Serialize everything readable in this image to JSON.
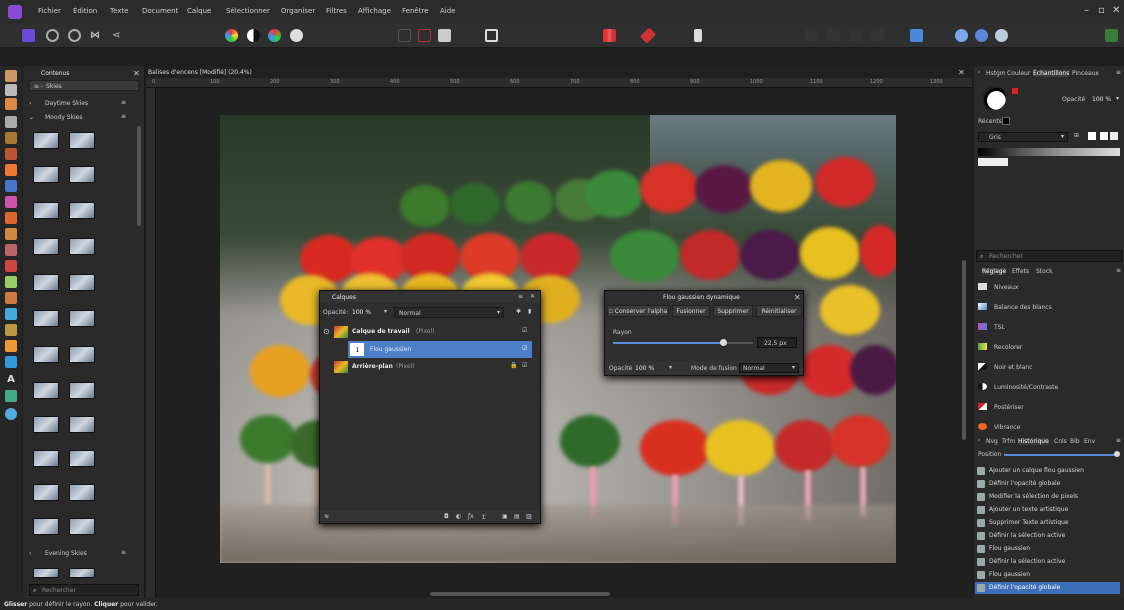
{
  "menu": [
    "Fichier",
    "Édition",
    "Texte",
    "Document",
    "Calque",
    "Sélectionner",
    "Organiser",
    "Filtres",
    "Affichage",
    "Fenêtre",
    "Aide"
  ],
  "window_controls": [
    "–",
    "▫",
    "✕"
  ],
  "left_panel": {
    "tab": "Contenus",
    "category": "Skies",
    "sections": [
      "Daytime Skies",
      "Moody Skies",
      "Evening Skies"
    ],
    "search_placeholder": "Rechercher"
  },
  "document_title": "Balises d'encens [Modifié] (20.4%)",
  "ruler_ticks": [
    "0",
    "100",
    "200",
    "300",
    "400",
    "500",
    "600",
    "700",
    "800",
    "900",
    "1000",
    "1100",
    "1200",
    "1300",
    "1400",
    "1500",
    "1600"
  ],
  "right_panel": {
    "top_tabs": [
      "Hstgm",
      "Couleur",
      "Échantillons",
      "Pinceaux"
    ],
    "opacity_label": "Opacité",
    "opacity_value": "100 %",
    "recent_label": "Récents",
    "palette_select": "Gris",
    "search_placeholder": "Rechercher",
    "adj_tabs": [
      "Réglage",
      "Effets",
      "Stock"
    ],
    "adjustments": [
      "Niveaux",
      "Balance des blancs",
      "TSL",
      "Recolorer",
      "Noir et blanc",
      "Luminosité/Contraste",
      "Postériser",
      "Vibrance"
    ],
    "hist_tabs": [
      "Nvg",
      "Trfm",
      "Historique",
      "Cnls",
      "Bib",
      "Env"
    ],
    "position_label": "Position :",
    "history": [
      "Ajouter un calque flou gaussien",
      "Définir l'opacité globale",
      "Modifier la sélection de pixels",
      "Ajouter un texte artistique",
      "Supprimer Texte artistique",
      "Définir la sélection active",
      "Flou gaussien",
      "Définir la sélection active",
      "Flou gaussien",
      "Définir l'opacité globale"
    ]
  },
  "layers_panel": {
    "title": "Calques",
    "opacity_label": "Opacité:",
    "opacity_value": "100 %",
    "blend": "Normal",
    "layers": [
      {
        "name": "Calque de travail",
        "type": "(Pixel)"
      },
      {
        "name": "Flou gaussien",
        "type": ""
      },
      {
        "name": "Arrière-plan",
        "type": "(Pixel)"
      }
    ]
  },
  "gauss_dialog": {
    "title": "Flou gaussien dynamique",
    "buttons": [
      "Conserver l'alpha",
      "Fusionner",
      "Supprimer",
      "Réinitialiser"
    ],
    "radius_label": "Rayon",
    "radius_value": "22,5 px",
    "radius_fraction": 0.45,
    "opacity_label": "Opacité",
    "opacity_value": "100 %",
    "blend_label": "Mode de fusion",
    "blend_value": "Normal"
  },
  "status": {
    "part1": "Glisser",
    "part2": " pour définir le rayon. ",
    "part3": "Cliquer",
    "part4": " pour valider."
  },
  "colors": {
    "accent": "#5b8bd6",
    "selection": "#4d7fc8",
    "highlight": "#3d6fb8"
  }
}
